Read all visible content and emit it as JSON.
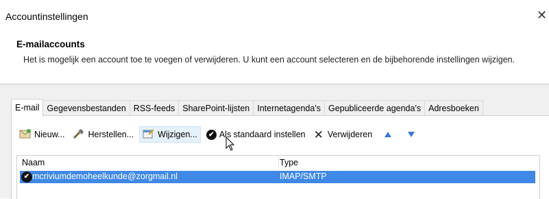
{
  "window": {
    "title": "Accountinstellingen",
    "close_glyph": "✕"
  },
  "header": {
    "title": "E-mailaccounts",
    "description": "Het is mogelijk een account toe te voegen of verwijderen. U kunt een account selecteren en de bijbehorende instellingen wijzigen."
  },
  "tabs": [
    {
      "label": "E-mail",
      "active": true
    },
    {
      "label": "Gegevensbestanden"
    },
    {
      "label": "RSS-feeds"
    },
    {
      "label": "SharePoint-lijsten"
    },
    {
      "label": "Internetagenda's"
    },
    {
      "label": "Gepubliceerde agenda's"
    },
    {
      "label": "Adresboeken"
    }
  ],
  "toolbar": {
    "new_label": "Nieuw...",
    "repair_label": "Herstellen...",
    "change_label": "Wijzigen...",
    "set_default_label": "Als standaard instellen",
    "remove_label": "Verwijderen",
    "check_glyph": "✔",
    "x_glyph": "✕"
  },
  "accounts_list": {
    "columns": {
      "name": "Naam",
      "type": "Type"
    },
    "rows": [
      {
        "name": "mcriviumdemoheelkunde@zorgmail.nl",
        "type": "IMAP/SMTP",
        "selected": true,
        "default": true
      }
    ]
  },
  "colors": {
    "selection": "#3f88e6",
    "arrow": "#3a78d8",
    "tab_border": "#d9d9d9"
  }
}
